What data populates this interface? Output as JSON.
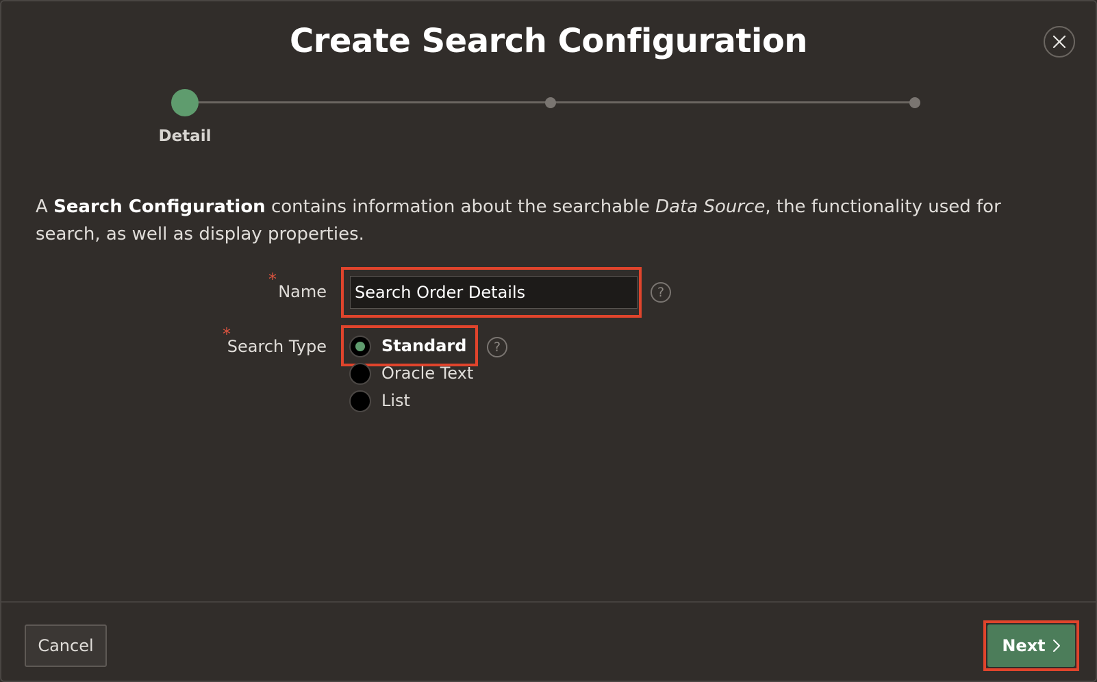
{
  "dialog": {
    "title": "Create Search Configuration",
    "close_icon": "close-icon"
  },
  "wizard": {
    "steps": [
      {
        "label": "Detail",
        "state": "current"
      },
      {
        "label": "",
        "state": "pending"
      },
      {
        "label": "",
        "state": "pending"
      }
    ]
  },
  "description": {
    "part1": "A ",
    "bold": "Search Configuration",
    "part2": " contains information about the searchable ",
    "italic": "Data Source",
    "part3": ", the functionality used for search, as well as display properties."
  },
  "form": {
    "required_marker": "*",
    "name": {
      "label": "Name",
      "value": "Search Order Details",
      "help": "?"
    },
    "search_type": {
      "label": "Search Type",
      "help": "?",
      "options": [
        {
          "label": "Standard",
          "selected": true
        },
        {
          "label": "Oracle Text",
          "selected": false
        },
        {
          "label": "List",
          "selected": false
        }
      ]
    }
  },
  "footer": {
    "cancel_label": "Cancel",
    "next_label": "Next",
    "next_icon": "chevron-right-icon"
  },
  "colors": {
    "background": "#312d2a",
    "accent_green": "#5f9c6e",
    "button_green": "#4c7d5a",
    "highlight_red": "#e0442c",
    "required_red": "#d9533f"
  }
}
